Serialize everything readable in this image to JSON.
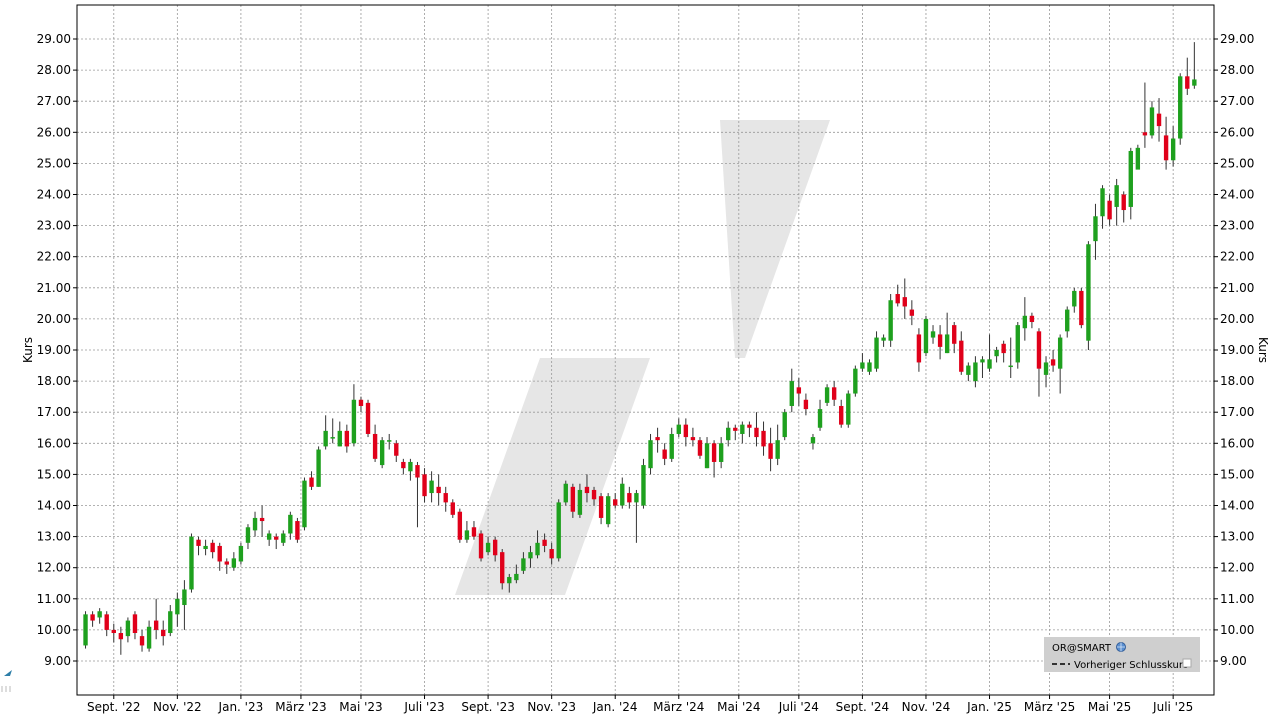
{
  "chart_data": {
    "type": "candlestick",
    "ylabel_left": "Kurs",
    "ylabel_right": "Kurs",
    "ylim": [
      8.0,
      30.2
    ],
    "yticks": [
      "9.00",
      "10.00",
      "11.00",
      "12.00",
      "13.00",
      "14.00",
      "15.00",
      "16.00",
      "17.00",
      "18.00",
      "19.00",
      "20.00",
      "21.00",
      "22.00",
      "23.00",
      "24.00",
      "25.00",
      "26.00",
      "27.00",
      "28.00",
      "29.00"
    ],
    "xlim_weeks": [
      0,
      160
    ],
    "xticks": [
      {
        "label": "Sept. '22",
        "week": 4.5
      },
      {
        "label": "Nov. '22",
        "week": 13.5
      },
      {
        "label": "Jan. '23",
        "week": 22.5
      },
      {
        "label": "März '23",
        "week": 31.0
      },
      {
        "label": "Mai '23",
        "week": 39.5
      },
      {
        "label": "Juli '23",
        "week": 48.5
      },
      {
        "label": "Sept. '23",
        "week": 57.5
      },
      {
        "label": "Nov. '23",
        "week": 66.5
      },
      {
        "label": "Jan. '24",
        "week": 75.5
      },
      {
        "label": "März '24",
        "week": 84.5
      },
      {
        "label": "Mai '24",
        "week": 93.0
      },
      {
        "label": "Juli '24",
        "week": 101.5
      },
      {
        "label": "Sept. '24",
        "week": 110.5
      },
      {
        "label": "Nov. '24",
        "week": 119.5
      },
      {
        "label": "Jan. '25",
        "week": 128.5
      },
      {
        "label": "März '25",
        "week": 137.0
      },
      {
        "label": "Mai '25",
        "week": 145.5
      },
      {
        "label": "Juli '25",
        "week": 154.5
      }
    ],
    "colors": {
      "up": "#1ea01e",
      "down": "#e0001a",
      "wick": "#333333",
      "grid": "#999999",
      "watermark": "#e6e6e6"
    },
    "series": [
      {
        "candles": [
          [
            9.5,
            10.5,
            9.4,
            10.6
          ],
          [
            10.5,
            10.3,
            10.1,
            10.6
          ],
          [
            10.4,
            10.6,
            10.2,
            10.7
          ],
          [
            10.5,
            10.0,
            9.8,
            10.6
          ],
          [
            10.0,
            9.9,
            9.6,
            10.2
          ],
          [
            9.9,
            9.7,
            9.2,
            10.1
          ],
          [
            9.8,
            10.3,
            9.6,
            10.4
          ],
          [
            10.5,
            9.9,
            9.7,
            10.6
          ],
          [
            9.8,
            9.5,
            9.3,
            10.0
          ],
          [
            9.4,
            10.1,
            9.3,
            10.3
          ],
          [
            10.3,
            10.0,
            9.7,
            11.0
          ],
          [
            10.0,
            9.8,
            9.5,
            10.3
          ],
          [
            9.9,
            10.6,
            9.8,
            10.8
          ],
          [
            10.5,
            11.0,
            10.1,
            11.2
          ],
          [
            10.8,
            11.3,
            10.0,
            11.6
          ],
          [
            11.3,
            13.0,
            11.2,
            13.1
          ],
          [
            12.9,
            12.7,
            12.4,
            13.0
          ],
          [
            12.6,
            12.7,
            12.4,
            12.9
          ],
          [
            12.8,
            12.5,
            12.3,
            12.9
          ],
          [
            12.7,
            12.2,
            11.9,
            12.8
          ],
          [
            12.2,
            12.1,
            11.8,
            12.3
          ],
          [
            12.0,
            12.3,
            11.9,
            12.5
          ],
          [
            12.2,
            12.7,
            12.1,
            12.8
          ],
          [
            12.8,
            13.3,
            12.6,
            13.4
          ],
          [
            13.2,
            13.6,
            13.0,
            13.8
          ],
          [
            13.6,
            13.5,
            13.0,
            14.0
          ],
          [
            12.9,
            13.1,
            12.7,
            13.2
          ],
          [
            13.0,
            12.9,
            12.6,
            13.1
          ],
          [
            12.8,
            13.1,
            12.7,
            13.2
          ],
          [
            13.1,
            13.7,
            12.9,
            13.8
          ],
          [
            13.5,
            12.9,
            12.8,
            13.6
          ],
          [
            13.3,
            14.8,
            13.2,
            14.9
          ],
          [
            14.9,
            14.6,
            14.5,
            15.1
          ],
          [
            14.6,
            15.8,
            14.6,
            15.9
          ],
          [
            15.9,
            16.4,
            15.8,
            16.9
          ],
          [
            16.2,
            16.2,
            16.0,
            16.8
          ],
          [
            15.9,
            16.4,
            15.9,
            16.7
          ],
          [
            16.4,
            15.9,
            15.7,
            16.6
          ],
          [
            16.0,
            17.4,
            15.9,
            17.9
          ],
          [
            17.4,
            17.2,
            17.0,
            17.5
          ],
          [
            17.3,
            16.3,
            16.2,
            17.4
          ],
          [
            16.3,
            15.5,
            15.4,
            16.6
          ],
          [
            15.3,
            16.1,
            15.2,
            16.2
          ],
          [
            16.1,
            16.1,
            15.8,
            16.3
          ],
          [
            16.0,
            15.6,
            15.4,
            16.1
          ],
          [
            15.4,
            15.2,
            15.0,
            15.5
          ],
          [
            15.1,
            15.4,
            14.8,
            15.5
          ],
          [
            15.3,
            14.9,
            13.3,
            15.4
          ],
          [
            15.0,
            14.3,
            14.1,
            15.2
          ],
          [
            14.4,
            14.8,
            14.1,
            15.1
          ],
          [
            14.6,
            14.4,
            14.0,
            15.0
          ],
          [
            14.4,
            14.1,
            13.8,
            14.6
          ],
          [
            14.1,
            13.7,
            13.6,
            14.2
          ],
          [
            13.8,
            12.9,
            12.8,
            13.9
          ],
          [
            12.9,
            13.2,
            12.8,
            13.5
          ],
          [
            13.3,
            13.0,
            12.9,
            13.5
          ],
          [
            13.1,
            12.3,
            12.2,
            13.2
          ],
          [
            12.5,
            12.8,
            12.4,
            13.0
          ],
          [
            12.9,
            12.4,
            12.2,
            13.0
          ],
          [
            12.5,
            11.5,
            11.3,
            12.6
          ],
          [
            11.5,
            11.7,
            11.2,
            11.8
          ],
          [
            11.6,
            11.8,
            11.5,
            12.1
          ],
          [
            11.9,
            12.3,
            11.8,
            12.5
          ],
          [
            12.3,
            12.5,
            12.0,
            12.7
          ],
          [
            12.4,
            12.8,
            12.3,
            13.2
          ],
          [
            12.9,
            12.7,
            12.5,
            13.1
          ],
          [
            12.6,
            12.3,
            12.1,
            12.8
          ],
          [
            12.3,
            14.1,
            12.2,
            14.2
          ],
          [
            14.1,
            14.7,
            14.0,
            14.8
          ],
          [
            14.6,
            13.8,
            13.6,
            14.7
          ],
          [
            13.7,
            14.5,
            13.6,
            14.7
          ],
          [
            14.6,
            14.4,
            14.1,
            15.0
          ],
          [
            14.5,
            14.2,
            14.0,
            14.6
          ],
          [
            14.3,
            13.6,
            13.4,
            14.4
          ],
          [
            13.4,
            14.3,
            13.3,
            14.4
          ],
          [
            14.2,
            14.0,
            13.9,
            14.4
          ],
          [
            14.0,
            14.7,
            13.9,
            14.9
          ],
          [
            14.4,
            14.1,
            13.9,
            14.6
          ],
          [
            14.1,
            14.4,
            12.8,
            14.5
          ],
          [
            14.0,
            15.3,
            13.9,
            15.5
          ],
          [
            15.2,
            16.1,
            15.0,
            16.3
          ],
          [
            16.2,
            16.1,
            15.7,
            16.5
          ],
          [
            15.8,
            15.5,
            15.3,
            16.0
          ],
          [
            15.5,
            16.3,
            15.4,
            16.5
          ],
          [
            16.3,
            16.6,
            16.2,
            16.8
          ],
          [
            16.6,
            16.2,
            15.9,
            16.8
          ],
          [
            16.2,
            16.1,
            15.9,
            16.5
          ],
          [
            16.1,
            15.6,
            15.5,
            16.2
          ],
          [
            15.2,
            16.0,
            15.2,
            16.2
          ],
          [
            16.0,
            15.4,
            14.9,
            16.1
          ],
          [
            15.4,
            16.0,
            15.2,
            16.2
          ],
          [
            16.1,
            16.5,
            15.9,
            16.7
          ],
          [
            16.5,
            16.4,
            16.1,
            16.6
          ],
          [
            16.3,
            16.6,
            16.0,
            16.7
          ],
          [
            16.6,
            16.5,
            16.2,
            16.7
          ],
          [
            16.5,
            16.2,
            15.9,
            17.0
          ],
          [
            16.4,
            15.9,
            15.6,
            16.7
          ],
          [
            16.0,
            15.5,
            15.1,
            16.5
          ],
          [
            15.5,
            16.1,
            15.3,
            16.6
          ],
          [
            16.2,
            17.0,
            16.1,
            17.1
          ],
          [
            17.2,
            18.0,
            17.0,
            18.4
          ],
          [
            17.8,
            17.6,
            17.2,
            18.1
          ],
          [
            17.4,
            17.1,
            16.9,
            17.6
          ],
          [
            16.0,
            16.2,
            15.8,
            16.3
          ],
          [
            16.5,
            17.1,
            16.4,
            17.4
          ],
          [
            17.3,
            17.8,
            17.2,
            17.9
          ],
          [
            17.8,
            17.4,
            17.2,
            18.0
          ],
          [
            17.2,
            16.6,
            16.5,
            17.4
          ],
          [
            16.6,
            17.6,
            16.5,
            17.7
          ],
          [
            17.6,
            18.4,
            17.5,
            18.5
          ],
          [
            18.4,
            18.6,
            18.3,
            18.9
          ],
          [
            18.3,
            18.6,
            18.2,
            18.7
          ],
          [
            18.4,
            19.4,
            18.3,
            19.6
          ],
          [
            19.3,
            19.4,
            19.1,
            19.5
          ],
          [
            19.3,
            20.6,
            19.1,
            20.8
          ],
          [
            20.8,
            20.5,
            20.4,
            21.1
          ],
          [
            20.7,
            20.4,
            20.0,
            21.3
          ],
          [
            20.3,
            20.1,
            19.8,
            20.6
          ],
          [
            19.5,
            18.6,
            18.3,
            19.7
          ],
          [
            18.9,
            20.0,
            18.8,
            20.1
          ],
          [
            19.4,
            19.6,
            19.2,
            19.8
          ],
          [
            19.5,
            19.1,
            18.7,
            19.8
          ],
          [
            18.9,
            19.5,
            18.9,
            20.2
          ],
          [
            19.8,
            19.2,
            18.9,
            19.9
          ],
          [
            19.3,
            18.3,
            18.2,
            19.6
          ],
          [
            18.2,
            18.5,
            18.0,
            18.6
          ],
          [
            18.0,
            18.6,
            17.8,
            18.8
          ],
          [
            18.6,
            18.7,
            18.1,
            18.8
          ],
          [
            18.4,
            18.7,
            18.3,
            19.5
          ],
          [
            18.8,
            19.0,
            18.6,
            19.1
          ],
          [
            19.2,
            18.9,
            18.6,
            19.3
          ],
          [
            18.5,
            18.5,
            18.1,
            19.4
          ],
          [
            18.6,
            19.8,
            18.4,
            19.9
          ],
          [
            19.7,
            20.1,
            19.3,
            20.7
          ],
          [
            20.1,
            19.9,
            19.7,
            20.2
          ],
          [
            19.6,
            18.4,
            17.5,
            19.7
          ],
          [
            18.2,
            18.6,
            17.8,
            18.8
          ],
          [
            18.7,
            18.5,
            18.3,
            19.0
          ],
          [
            18.4,
            19.4,
            17.6,
            19.5
          ],
          [
            19.6,
            20.3,
            19.4,
            20.4
          ],
          [
            20.4,
            20.9,
            20.2,
            21.0
          ],
          [
            20.9,
            19.8,
            19.7,
            21.0
          ],
          [
            19.3,
            22.4,
            19.0,
            22.5
          ],
          [
            22.5,
            23.3,
            21.9,
            23.7
          ],
          [
            23.3,
            24.2,
            22.9,
            24.3
          ],
          [
            23.8,
            23.2,
            23.0,
            24.0
          ],
          [
            23.6,
            24.3,
            23.0,
            24.5
          ],
          [
            24.0,
            23.5,
            23.1,
            24.1
          ],
          [
            23.6,
            25.4,
            23.2,
            25.5
          ],
          [
            24.8,
            25.5,
            24.9,
            25.6
          ],
          [
            26.0,
            25.9,
            25.5,
            27.6
          ],
          [
            25.9,
            26.8,
            25.8,
            27.0
          ],
          [
            26.6,
            26.2,
            25.7,
            27.1
          ],
          [
            25.9,
            25.1,
            24.8,
            26.5
          ],
          [
            25.1,
            25.8,
            24.9,
            26.2
          ],
          [
            25.8,
            27.8,
            25.6,
            27.9
          ],
          [
            27.8,
            27.4,
            27.2,
            28.4
          ],
          [
            27.5,
            27.7,
            27.4,
            28.9
          ]
        ]
      }
    ],
    "legend": {
      "title": "OR@SMART",
      "items": [
        "Vorheriger Schlusskurs"
      ],
      "placement": "bottom-right"
    }
  }
}
